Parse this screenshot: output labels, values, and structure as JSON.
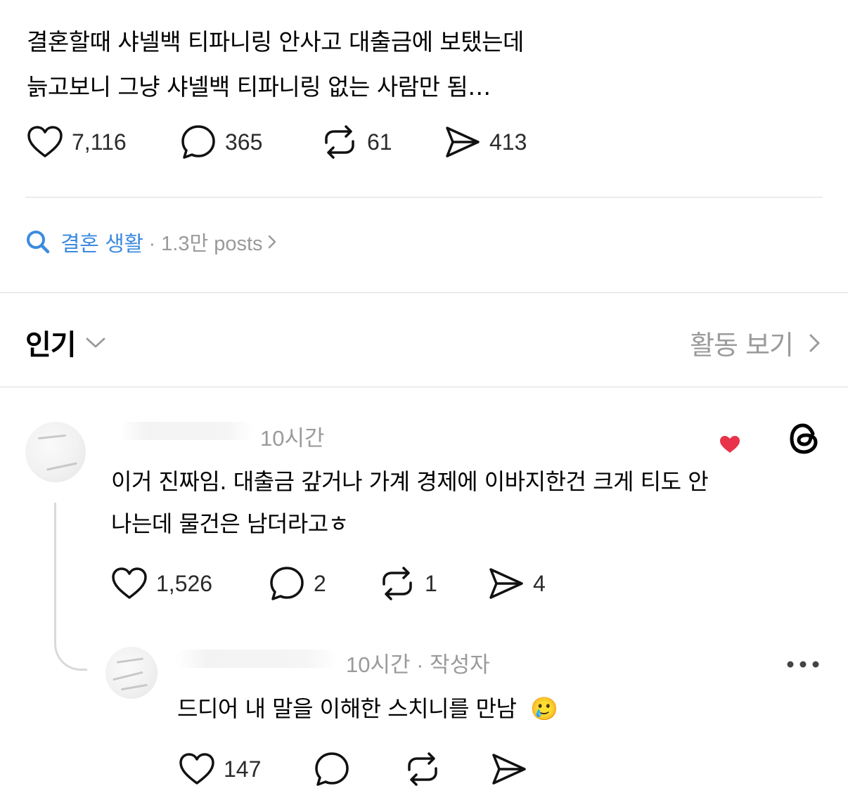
{
  "post": {
    "lines": [
      "결혼할때 샤넬백 티파니링 안사고 대출금에 보탰는데",
      "늙고보니 그냥 샤넬백 티파니링 없는 사람만 됨…"
    ],
    "actions": {
      "likes": "7,116",
      "comments": "365",
      "reposts": "61",
      "shares": "413"
    }
  },
  "topic": {
    "tag": "결혼 생활",
    "meta": "· 1.3만 posts"
  },
  "section": {
    "title": "인기",
    "activity_link": "활동 보기"
  },
  "comments": [
    {
      "time": "10시간",
      "lines": [
        "이거 진짜임. 대출금 갚거나 가계 경제에 이바지한건 크게 티도 안",
        "나는데 물건은 남더라고ㅎ"
      ],
      "actions": {
        "likes": "1,526",
        "comments": "2",
        "reposts": "1",
        "shares": "4"
      },
      "author_liked": true
    },
    {
      "time": "10시간 · 작성자",
      "text": "드디어 내 말을 이해한 스치니를 만남",
      "emoji": "🥲",
      "actions": {
        "likes": "147"
      }
    }
  ],
  "colors": {
    "accent": "#3d8be0",
    "muted": "#9a9a9a",
    "heart": "#e8334a",
    "divider": "#dcdcdc"
  },
  "icons": [
    "heart-icon",
    "comment-icon",
    "repost-icon",
    "share-icon",
    "search-icon",
    "chevron-down-icon",
    "chevron-right-icon",
    "threads-logo-icon",
    "more-icon"
  ]
}
